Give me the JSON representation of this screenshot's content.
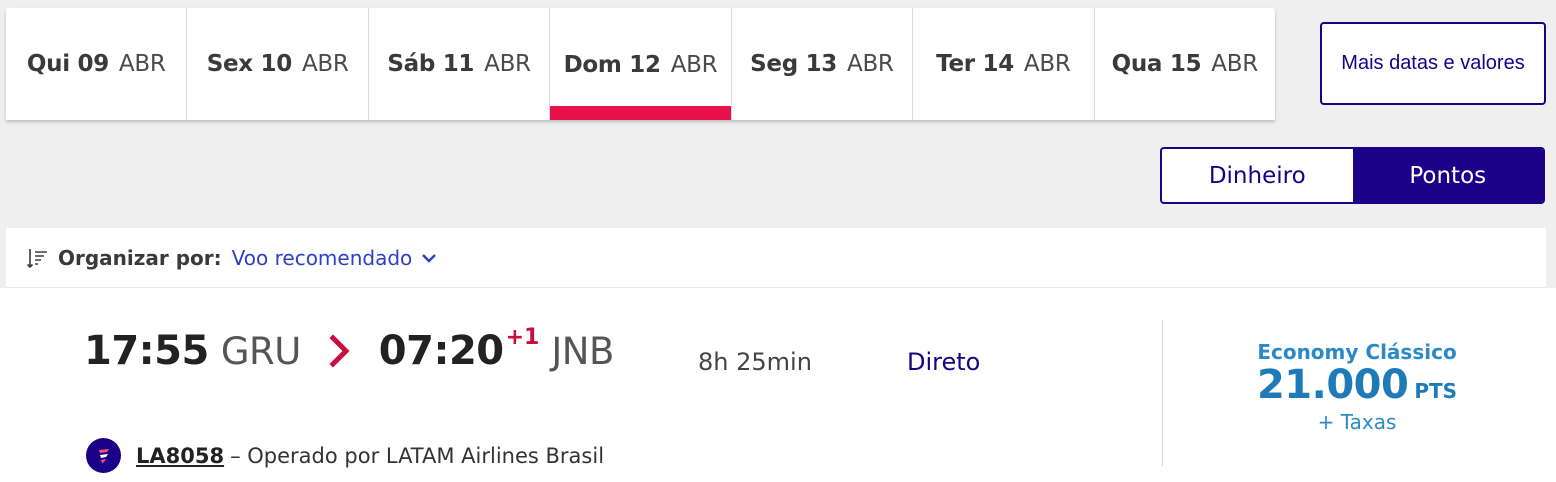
{
  "date_tabs": [
    {
      "day": "Qui 09",
      "month": "ABR",
      "active": false
    },
    {
      "day": "Sex 10",
      "month": "ABR",
      "active": false
    },
    {
      "day": "Sáb 11",
      "month": "ABR",
      "active": false
    },
    {
      "day": "Dom 12",
      "month": "ABR",
      "active": true
    },
    {
      "day": "Seg 13",
      "month": "ABR",
      "active": false
    },
    {
      "day": "Ter 14",
      "month": "ABR",
      "active": false
    },
    {
      "day": "Qua 15",
      "month": "ABR",
      "active": false
    }
  ],
  "more_dates_label": "Mais datas e valores",
  "currency": {
    "cash_label": "Dinheiro",
    "points_label": "Pontos",
    "selected": "Pontos"
  },
  "sort": {
    "label": "Organizar por:",
    "value": "Voo recomendado"
  },
  "flight": {
    "departure_time": "17:55",
    "departure_airport": "GRU",
    "arrival_time": "07:20",
    "arrival_day_offset": "+1",
    "arrival_airport": "JNB",
    "duration": "8h 25min",
    "stops": "Direto",
    "flight_number": "LA8058",
    "operated_by": "– Operado por LATAM Airlines Brasil",
    "fare": {
      "brand": "Economy Clássico",
      "price": "21.000",
      "unit": "PTS",
      "taxes": "+ Taxas"
    }
  },
  "colors": {
    "accent": "#1b0088",
    "active_tab_bar": "#e8114b",
    "fare_blue": "#1f7bb8",
    "arrow_red": "#c8103e"
  },
  "icons": [
    "sort-icon",
    "chevron-down-icon",
    "chevron-right-icon",
    "latam-logo-icon"
  ]
}
